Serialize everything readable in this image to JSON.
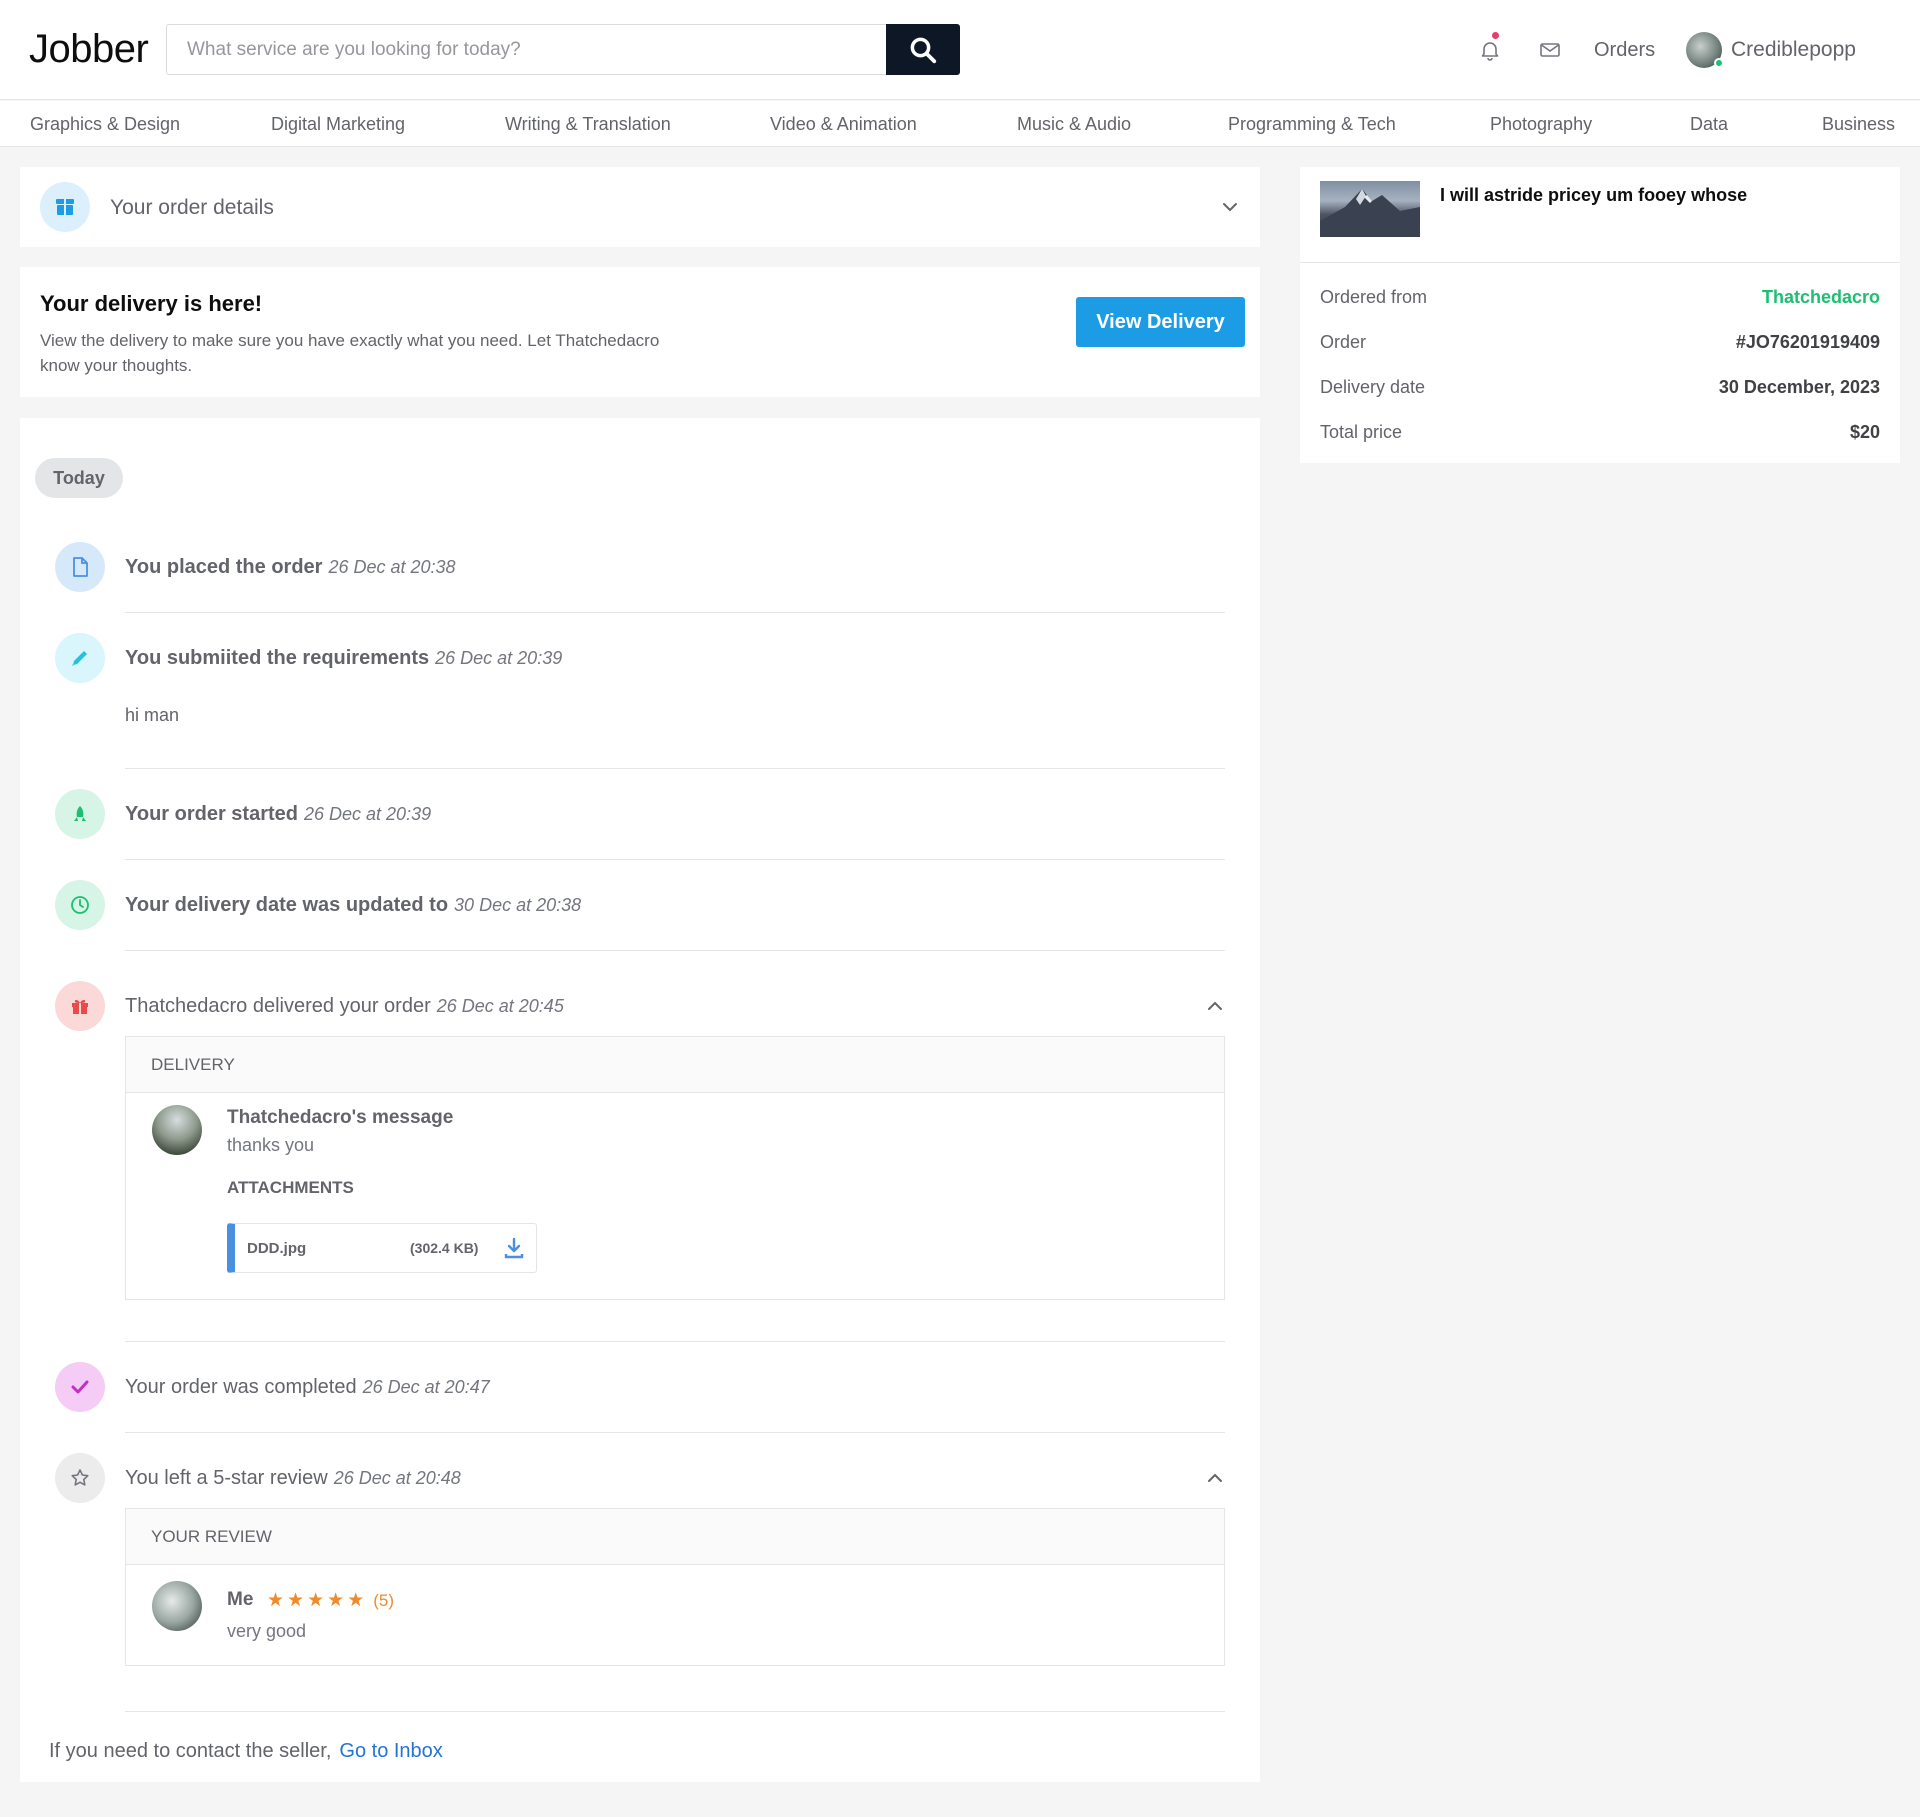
{
  "header": {
    "logo": "Jobber",
    "search_placeholder": "What service are you looking for today?",
    "orders": "Orders",
    "username": "Crediblepopp"
  },
  "categories": [
    "Graphics & Design",
    "Digital Marketing",
    "Writing & Translation",
    "Video & Animation",
    "Music & Audio",
    "Programming & Tech",
    "Photography",
    "Data",
    "Business"
  ],
  "order_details": {
    "title": "Your order details"
  },
  "delivery_banner": {
    "title": "Your delivery is here!",
    "text": "View the delivery to make sure you have exactly what you need. Let Thatchedacro know your thoughts.",
    "button": "View Delivery"
  },
  "timeline": {
    "today": "Today",
    "events": [
      {
        "label": "You placed the order",
        "time": "26 Dec at 20:38",
        "icon": "document-icon"
      },
      {
        "label": "You submiited the requirements",
        "time": "26 Dec at 20:39",
        "icon": "pencil-icon",
        "message": "hi man"
      },
      {
        "label": "Your order started",
        "time": "26 Dec at 20:39",
        "icon": "rocket-icon"
      },
      {
        "label": "Your delivery date was updated to",
        "time": "30 Dec at 20:38",
        "icon": "clock-icon"
      },
      {
        "label": "Thatchedacro delivered your order",
        "time": "26 Dec at 20:45",
        "icon": "gift-icon"
      },
      {
        "label": "Your order was completed",
        "time": "26 Dec at 20:47",
        "icon": "check-icon"
      },
      {
        "label": "You left a 5-star review",
        "time": "26 Dec at 20:48",
        "icon": "star-icon"
      }
    ],
    "delivery": {
      "heading": "DELIVERY",
      "sender": "Thatchedacro's message",
      "message": "thanks you",
      "attachments_label": "ATTACHMENTS",
      "file_name": "DDD.jpg",
      "file_size": "(302.4 KB)"
    },
    "review": {
      "heading": "YOUR REVIEW",
      "author": "Me",
      "rating": 5,
      "rating_text": "(5)",
      "text": "very good"
    },
    "contact_text": "If you need to contact the seller,",
    "contact_link": "Go to Inbox"
  },
  "sidebar": {
    "gig_title": "I will astride pricey um fooey whose",
    "rows": [
      {
        "label": "Ordered from",
        "value": "Thatchedacro"
      },
      {
        "label": "Order",
        "value": "#JO76201919409"
      },
      {
        "label": "Delivery date",
        "value": "30 December, 2023"
      },
      {
        "label": "Total price",
        "value": "$20"
      }
    ]
  },
  "colors": {
    "accent_blue": "#1d9ce6",
    "seller_green": "#1dbf73",
    "star_orange": "#ef8b2c",
    "link_blue": "#2474d6"
  }
}
